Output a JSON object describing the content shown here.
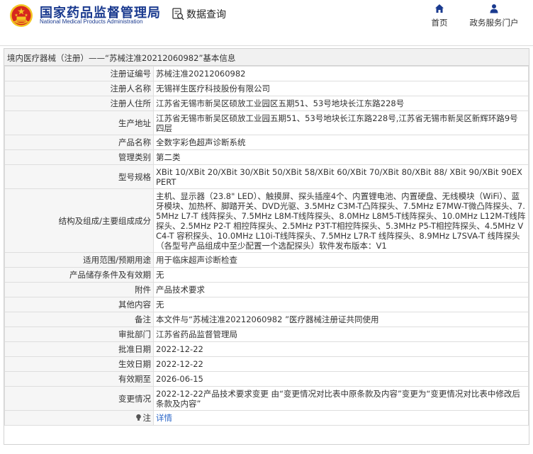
{
  "header": {
    "site_name_cn": "国家药品监督管理局",
    "site_name_en": "National Medical Products Administration",
    "query_label": "数据查询",
    "nav_home": "首页",
    "nav_portal": "政务服务门户"
  },
  "breadcrumb": {
    "category": "境内医疗器械（注册）",
    "separator": "——",
    "title": "“苏械注准20212060982”基本信息"
  },
  "rows": [
    {
      "label": "注册证编号",
      "value": "苏械注准20212060982"
    },
    {
      "label": "注册人名称",
      "value": "无锡祥生医疗科技股份有限公司"
    },
    {
      "label": "注册人住所",
      "value": "江苏省无锡市新吴区硕放工业园区五期51、53号地块长江东路228号"
    },
    {
      "label": "生产地址",
      "value": "江苏省无锡市新吴区硕放工业园五期51、53号地块长江东路228号,江苏省无锡市新吴区新辉环路9号四层"
    },
    {
      "label": "产品名称",
      "value": "全数字彩色超声诊断系统"
    },
    {
      "label": "管理类别",
      "value": "第二类"
    },
    {
      "label": "型号规格",
      "value": "XBit 10/XBit 20/XBit 30/XBit 50/XBit 58/XBit 60/XBit 70/XBit 80/XBit 88/ XBit 90/XBit 90EXPERT"
    },
    {
      "label": "结构及组成/主要组成成分",
      "value": "主机、显示器（23.8\" LED）、触摸屏、探头插座4个、内置锂电池、内置硬盘、无线模块（WiFi）、蓝牙模块、加热杯、脚踏开关、DVD光驱、3.5MHz C3M-T凸阵探头、7.5MHz E7MW-T微凸阵探头、7.5MHz L7-T 线阵探头、7.5MHz L8M-T线阵探头、8.0MHz L8M5-T线阵探头、10.0MHz L12M-T线阵探头、2.5MHz P2-T 相控阵探头、2.5MHz P3T-T相控阵探头、5.3MHz P5-T相控阵探头、4.5MHz VC4-T 容积探头、10.0MHz L10i-T线阵探头、7.5MHz L7R-T 线阵探头、8.9MHz L7SVA-T 线阵探头（各型号产品组成中至少配置一个选配探头）软件发布版本：V1"
    },
    {
      "label": "适用范围/预期用途",
      "value": "用于临床超声诊断检查"
    },
    {
      "label": "产品储存条件及有效期",
      "value": "无"
    },
    {
      "label": "附件",
      "value": "产品技术要求"
    },
    {
      "label": "其他内容",
      "value": "无"
    },
    {
      "label": "备注",
      "value": "本文件与“苏械注准20212060982 ”医疗器械注册证共同使用"
    },
    {
      "label": "审批部门",
      "value": "江苏省药品监督管理局"
    },
    {
      "label": "批准日期",
      "value": "2022-12-22"
    },
    {
      "label": "生效日期",
      "value": "2022-12-22"
    },
    {
      "label": "有效期至",
      "value": "2026-06-15"
    },
    {
      "label": "变更情况",
      "value": "2022-12-22产品技术要求变更 由“变更情况对比表中原条款及内容”变更为“变更情况对比表中修改后条款及内容”"
    }
  ],
  "note": {
    "label": "注",
    "link_text": "详情"
  },
  "colors": {
    "brand_blue": "#1a3a8f",
    "emblem_red": "#d7261e",
    "emblem_gold": "#f3c623",
    "link_blue": "#2a66c8"
  }
}
